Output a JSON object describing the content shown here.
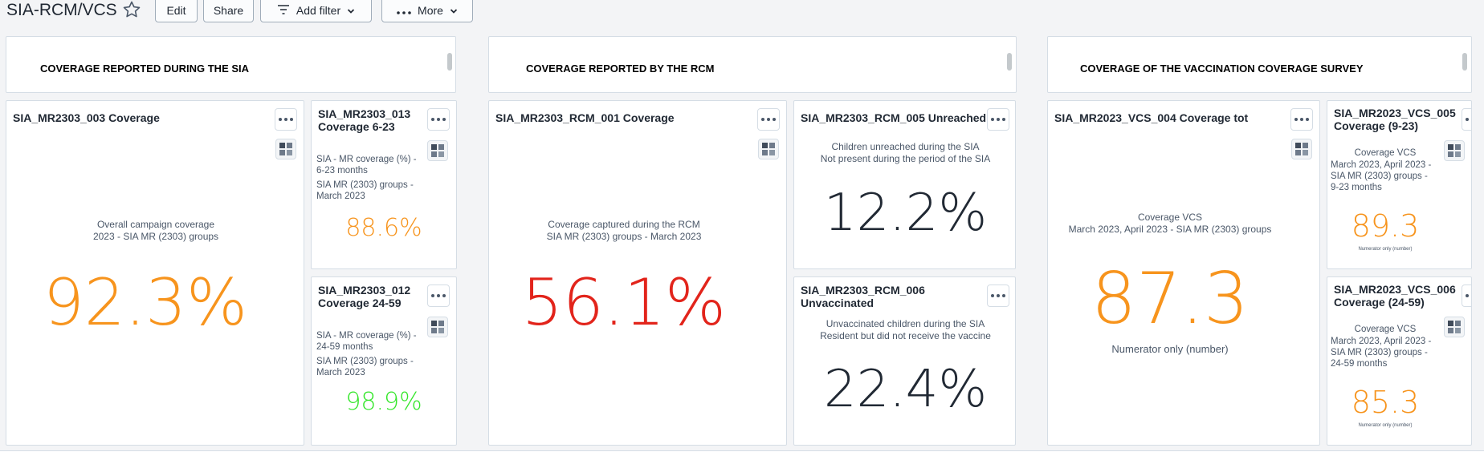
{
  "header": {
    "title": "SIA-RCM/VCS",
    "edit": "Edit",
    "share": "Share",
    "add_filter": "Add filter",
    "more": "More"
  },
  "sections": {
    "sia": "COVERAGE REPORTED DURING THE SIA",
    "rcm": "COVERAGE REPORTED BY THE RCM",
    "vcs": "COVERAGE OF THE VACCINATION COVERAGE SURVEY"
  },
  "cards": {
    "c003": {
      "title": "SIA_MR2303_003 Coverage",
      "sub1": "Overall campaign coverage",
      "sub2": "2023 - SIA MR (2303) groups",
      "value": "92.3%"
    },
    "c013": {
      "title1": "SIA_MR2303_013",
      "title2": "Coverage 6-23",
      "sub1": "SIA - MR coverage (%) -",
      "sub2": "6-23 months",
      "sub3": "SIA MR (2303) groups -",
      "sub4": "March 2023",
      "value": "88.6%"
    },
    "c012": {
      "title1": "SIA_MR2303_012",
      "title2": "Coverage 24-59",
      "sub1": "SIA - MR coverage (%) -",
      "sub2": "24-59 months",
      "sub3": "SIA MR (2303) groups -",
      "sub4": "March 2023",
      "value": "98.9%"
    },
    "rcm001": {
      "title": "SIA_MR2303_RCM_001 Coverage",
      "sub1": "Coverage captured during the RCM",
      "sub2": "SIA MR (2303) groups - March 2023",
      "value": "56.1%"
    },
    "rcm005": {
      "title": "SIA_MR2303_RCM_005 Unreached",
      "sub1": "Children unreached during the SIA",
      "sub2": "Not present during the period of the SIA",
      "value": "12.2%"
    },
    "rcm006": {
      "title1": "SIA_MR2303_RCM_006",
      "title2": "Unvaccinated",
      "sub1": "Unvaccinated children during the SIA",
      "sub2": "Resident but did not receive the vaccine",
      "value": "22.4%"
    },
    "vcs004": {
      "title": "SIA_MR2023_VCS_004 Coverage tot",
      "sub1": "Coverage VCS",
      "sub2": "March 2023, April 2023 - SIA MR (2303) groups",
      "value": "87.3",
      "foot": "Numerator only (number)"
    },
    "vcs005": {
      "title1": "SIA_MR2023_VCS_005",
      "title2": "Coverage (9-23)",
      "sub1": "Coverage VCS",
      "sub2": "March 2023, April 2023 -",
      "sub3": "SIA MR (2303) groups -",
      "sub4": "9-23 months",
      "value": "89.3",
      "foot": "Numerator only (number)"
    },
    "vcs006": {
      "title1": "SIA_MR2023_VCS_006",
      "title2": "Coverage (24-59)",
      "sub1": "Coverage VCS",
      "sub2": "March 2023, April 2023 -",
      "sub3": "SIA MR (2303) groups -",
      "sub4": "24-59 months",
      "value": "85.3",
      "foot": "Numerator only (number)"
    }
  },
  "colors": {
    "orange": "#f7941d",
    "red": "#e2241b",
    "green": "#34e62a",
    "dark": "#212934"
  }
}
